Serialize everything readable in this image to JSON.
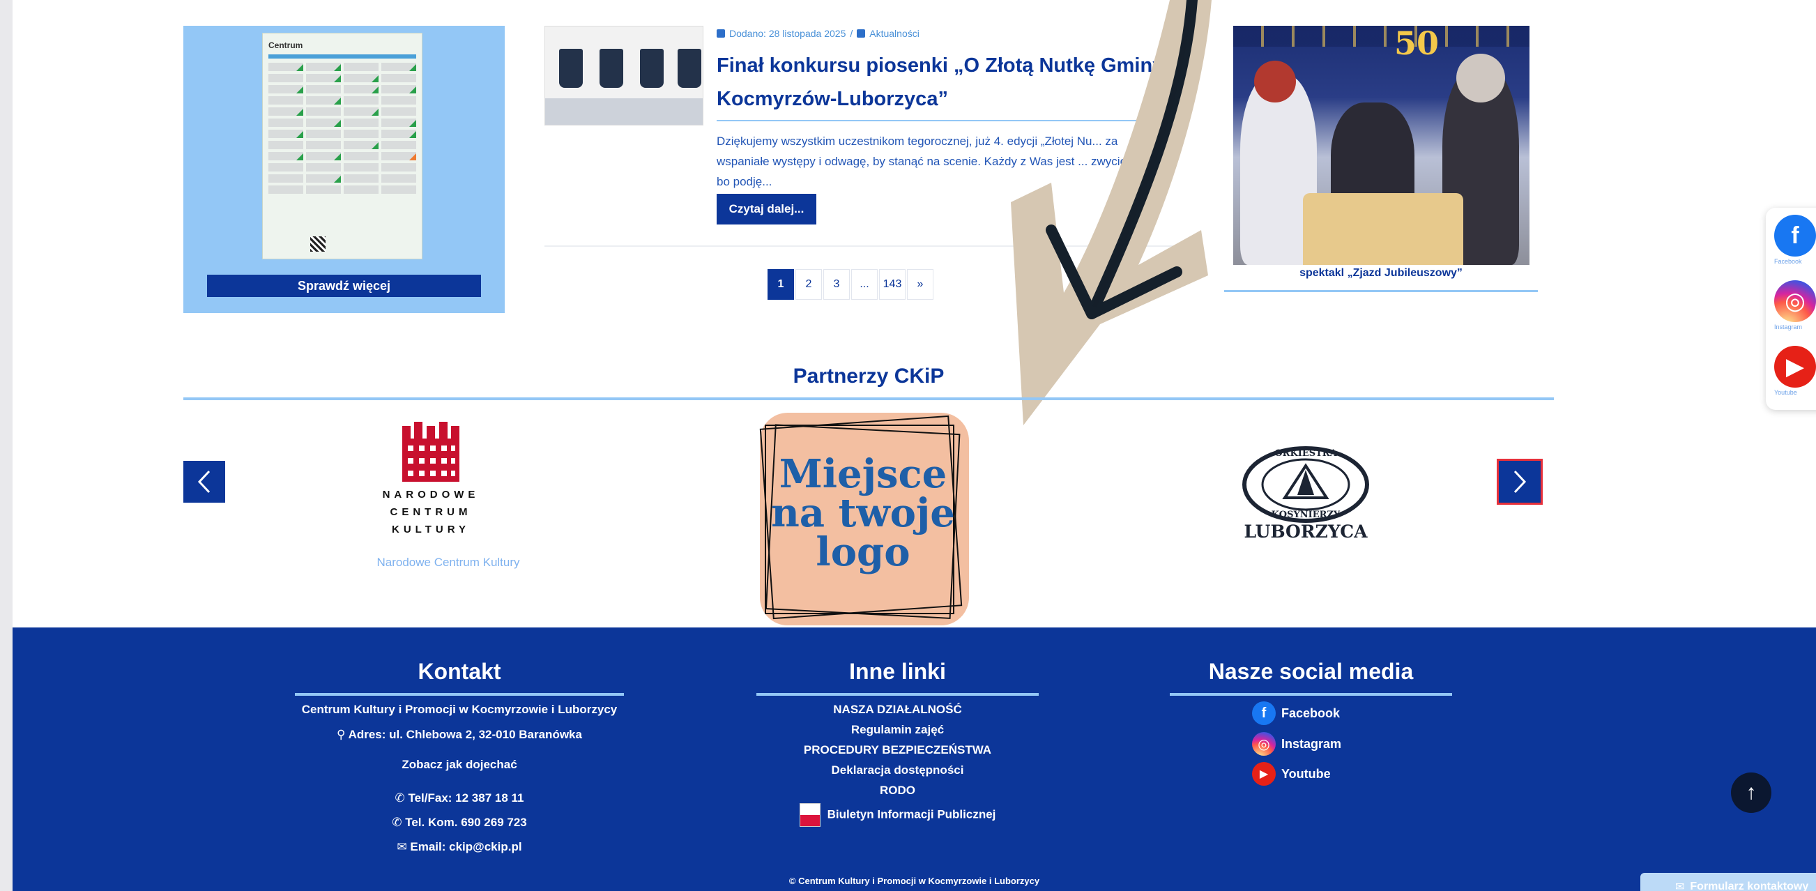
{
  "promo": {
    "schedule_title": "Centrum",
    "button_label": "Sprawdź więcej"
  },
  "article": {
    "date": "Dodano: 28 listopada 2025",
    "separator": "/",
    "category": "Aktualności",
    "title": "Finał konkursu piosenki „O Złotą Nutkę Gminy Kocmyrzów-Luborzyca”",
    "excerpt": "Dziękujemy wszystkim uczestnikom tegorocznej, już 4. edycji „Złotej Nu... za wspaniałe występy i odwagę, by stanąć na scenie. Każdy z Was jest ... zwycięzcą – bo podję...",
    "read_more_label": "Czytaj dalej..."
  },
  "pagination": {
    "pages": [
      "1",
      "2",
      "3",
      "...",
      "143",
      "»"
    ],
    "current": "1"
  },
  "photo": {
    "banner_number": "50",
    "caption": "spektakl „Zjazd Jubileuszowy”"
  },
  "partners": {
    "heading": "Partnerzy CKiP",
    "prev_label": "‹",
    "next_label": "›",
    "items": [
      {
        "logo_text": [
          "NARODOWE",
          "CENTRUM",
          "KULTURY"
        ],
        "caption": "Narodowe Centrum Kultury"
      },
      {
        "logo_text": [
          "Miejsce",
          "na twoje",
          "logo"
        ]
      },
      {
        "logo_text": [
          "LUBORZYCA"
        ],
        "ring_text_top": "ORKIESTRA",
        "ring_text_bottom": "KOSYNIERZY"
      }
    ]
  },
  "social_side": {
    "items": [
      {
        "label": "Facebook",
        "glyph": "f",
        "color": "#1877f2"
      },
      {
        "label": "Instagram",
        "glyph": "◎",
        "color": "#d62976"
      },
      {
        "label": "Youtube",
        "glyph": "▶",
        "color": "#e62117"
      }
    ]
  },
  "footer": {
    "kontakt": {
      "heading": "Kontakt",
      "org": "Centrum Kultury i Promocji w Kocmyrzowie i Luborzycy",
      "address": "Adres: ul. Chlebowa 2, 32-010 Baranówka",
      "directions": "Zobacz jak dojechać",
      "tel_fax": "Tel/Fax: 12 387 18 11",
      "tel_kom": "Tel. Kom. 690 269 723",
      "email": "Email: ckip@ckip.pl"
    },
    "links": {
      "heading": "Inne linki",
      "items": [
        "NASZA DZIAŁALNOŚĆ",
        "Regulamin zajęć",
        "PROCEDURY BEZPIECZEŃSTWA",
        "Deklaracja dostępności",
        "RODO"
      ],
      "bip": "Biuletyn Informacji Publicznej"
    },
    "social": {
      "heading": "Nasze social media",
      "items": [
        {
          "label": "Facebook",
          "glyph": "f",
          "color": "#1877f2"
        },
        {
          "label": "Instagram",
          "glyph": "◎",
          "color": "#d62976"
        },
        {
          "label": "Youtube",
          "glyph": "▶",
          "color": "#e62117"
        }
      ]
    },
    "copyright": "© Centrum Kultury i Promocji w Kocmyrzowie i Luborzycy",
    "scroll_top_glyph": "↑",
    "contact_form_label": "Formularz kontaktowy"
  },
  "colors": {
    "brand_blue": "#0c3699",
    "light_blue": "#93c7f6",
    "arrow_paper": "#d6c7b2",
    "arrow_ink": "#15202b",
    "ad_bg": "#f3bfa1",
    "ad_text": "#1e5fa8",
    "crown_red": "#c8102e"
  }
}
